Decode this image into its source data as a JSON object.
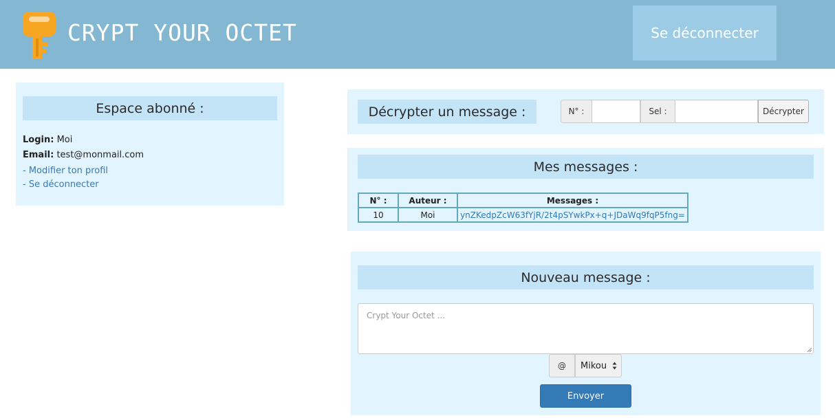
{
  "header": {
    "brand": "CRYPT YOUR OCTET",
    "logout_label": "Se déconnecter",
    "logo_color": "#f6a623",
    "background_color": "#84b8d2"
  },
  "sidebar": {
    "title": "Espace abonné :",
    "login_label": "Login:",
    "login_value": "Moi",
    "email_label": "Email:",
    "email_value": "test@monmail.com",
    "link_dash": "-",
    "edit_profile_link": "Modifier ton profil",
    "logout_link": "Se déconnecter"
  },
  "decrypt": {
    "title": "Décrypter un message :",
    "number_label": "N° :",
    "number_value": "",
    "salt_label": "Sel :",
    "salt_value": "",
    "button_label": "Décrypter"
  },
  "messages": {
    "title": "Mes messages :",
    "columns": [
      "N° :",
      "Auteur :",
      "Messages :"
    ],
    "rows": [
      {
        "number": "10",
        "author": "Moi",
        "message": "ynZKedpZcW63fYjR/2t4pSYwkPx+q+JDaWq9fqP5fng="
      }
    ]
  },
  "new_message": {
    "title": "Nouveau message :",
    "placeholder": "Crypt Your Octet ...",
    "at_label": "@",
    "recipient_selected": "Mikou",
    "send_label": "Envoyer"
  },
  "colors": {
    "panel_bg": "#e2f5ff",
    "panel_title_bg": "#c3e3f7",
    "link": "#337ab7",
    "primary_button": "#337ab7",
    "table_border": "#62a9bf"
  },
  "icons": {
    "logo": "key-icon",
    "number_spinner": "spinner-icon",
    "select_arrows": "select-arrows-icon",
    "textarea_resize": "resize-grip-icon"
  }
}
